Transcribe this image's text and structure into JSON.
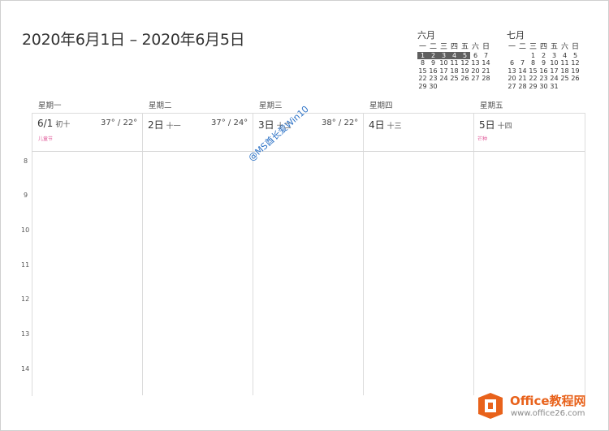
{
  "title": "2020年6月1日 – 2020年6月5日",
  "mini_calendars": [
    {
      "month": "六月",
      "weekdays": [
        "一",
        "二",
        "三",
        "四",
        "五",
        "六",
        "日"
      ],
      "rows": [
        [
          "1",
          "2",
          "3",
          "4",
          "5",
          "6",
          "7"
        ],
        [
          "8",
          "9",
          "10",
          "11",
          "12",
          "13",
          "14"
        ],
        [
          "15",
          "16",
          "17",
          "18",
          "19",
          "20",
          "21"
        ],
        [
          "22",
          "23",
          "24",
          "25",
          "26",
          "27",
          "28"
        ],
        [
          "29",
          "30",
          "",
          "",
          "",
          "",
          ""
        ]
      ],
      "highlighted": [
        "1",
        "2",
        "3",
        "4",
        "5"
      ]
    },
    {
      "month": "七月",
      "weekdays": [
        "一",
        "二",
        "三",
        "四",
        "五",
        "六",
        "日"
      ],
      "rows": [
        [
          "",
          "",
          "1",
          "2",
          "3",
          "4",
          "5"
        ],
        [
          "6",
          "7",
          "8",
          "9",
          "10",
          "11",
          "12"
        ],
        [
          "13",
          "14",
          "15",
          "16",
          "17",
          "18",
          "19"
        ],
        [
          "20",
          "21",
          "22",
          "23",
          "24",
          "25",
          "26"
        ],
        [
          "27",
          "28",
          "29",
          "30",
          "31",
          "",
          ""
        ]
      ],
      "highlighted": []
    }
  ],
  "days": [
    {
      "weekday": "星期一",
      "date": "6/1",
      "lunar": "初十",
      "temp": "37° / 22°",
      "holiday": "儿童节"
    },
    {
      "weekday": "星期二",
      "date": "2日",
      "lunar": "十一",
      "temp": "37° / 24°",
      "holiday": ""
    },
    {
      "weekday": "星期三",
      "date": "3日",
      "lunar": "十二",
      "temp": "38° / 22°",
      "holiday": ""
    },
    {
      "weekday": "星期四",
      "date": "4日",
      "lunar": "十三",
      "temp": "",
      "holiday": ""
    },
    {
      "weekday": "星期五",
      "date": "5日",
      "lunar": "十四",
      "temp": "",
      "holiday": "芒种"
    }
  ],
  "hours": [
    "8",
    "9",
    "10",
    "11",
    "12",
    "13",
    "14"
  ],
  "watermark": "@MS酋长爱Win10",
  "logo": {
    "line1": "Office教程网",
    "line2": "www.office26.com"
  },
  "colors": {
    "holiday": "#e05a9a",
    "highlight": "#5f5f5f",
    "logo_orange": "#e8621b",
    "watermark": "#2f74c7"
  }
}
